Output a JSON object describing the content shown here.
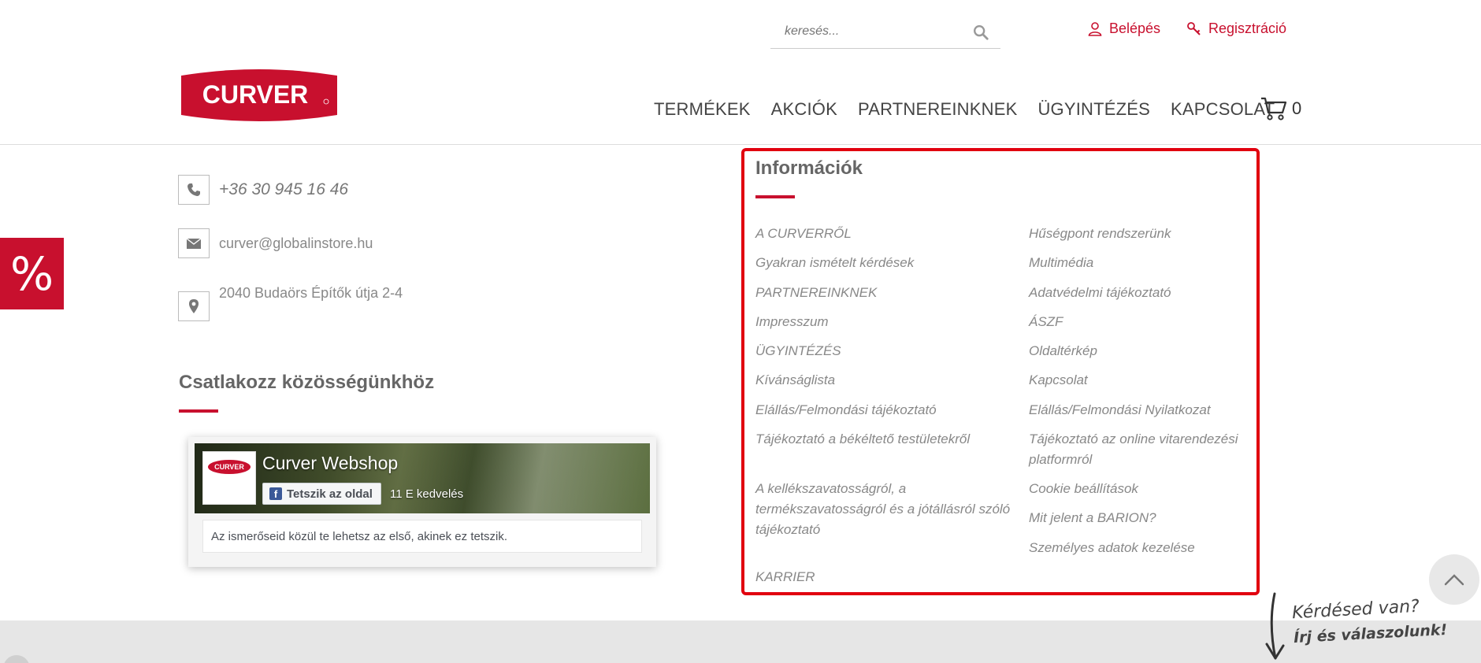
{
  "header": {
    "search_placeholder": "keresés...",
    "login": "Belépés",
    "register": "Regisztráció",
    "logo_text": "CURVER",
    "nav": [
      "TERMÉKEK",
      "AKCIÓK",
      "PARTNEREINKNEK",
      "ÜGYINTÉZÉS",
      "KAPCSOLAT"
    ],
    "cart_count": "0"
  },
  "contact": {
    "phone": "+36 30 945 16 46",
    "email": "curver@globalinstore.hu",
    "address": "2040 Budaörs Építők útja 2-4"
  },
  "promo_symbol": "%",
  "community": {
    "title": "Csatlakozz közösségünkhöz"
  },
  "facebook": {
    "page_name": "Curver Webshop",
    "like_button": "Tetszik az oldal",
    "likes": "11 E kedvelés",
    "footer_text": "Az ismerőseid közül te lehetsz az első, akinek ez tetszik."
  },
  "info": {
    "title": "Információk",
    "left_links": [
      "A CURVERRŐL",
      "Gyakran ismételt kérdések",
      "PARTNEREINKNEK",
      "Impresszum",
      "ÜGYINTÉZÉS",
      "Kívánságlista",
      "Elállás/Felmondási tájékoztató",
      "Tájékoztató a békéltető testületekről",
      "A kellékszavatosságról, a termékszavatosságról és a jótállásról szóló tájékoztató",
      "KARRIER"
    ],
    "right_links": [
      "Hűségpont rendszerünk",
      "Multimédia",
      "Adatvédelmi tájékoztató",
      "ÁSZF",
      "Oldaltérkép",
      "Kapcsolat",
      "Elállás/Felmondási Nyilatkozat",
      "Tájékoztató az online vitarendezési platformról",
      "Cookie beállítások",
      "Mit jelent a BARION?",
      "Személyes adatok kezelése"
    ]
  },
  "chat": {
    "question": "Kérdésed van?",
    "prompt": "Írj és válaszolunk!"
  },
  "colors": {
    "brand_red": "#c8102e",
    "highlight_border": "#e1000f"
  }
}
